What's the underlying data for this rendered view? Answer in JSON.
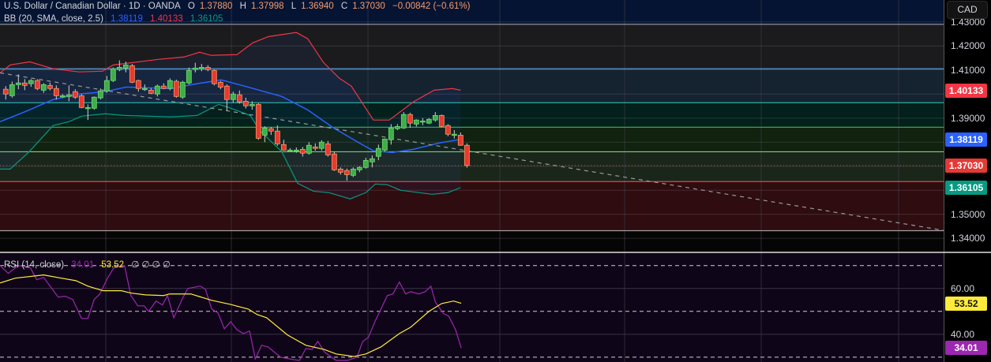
{
  "legend": {
    "symbol": "U.S. Dollar / Canadian Dollar · 1D · OANDA",
    "o_label": "O",
    "o": "1.37880",
    "h_label": "H",
    "h": "1.37998",
    "l_label": "L",
    "l": "1.36940",
    "c_label": "C",
    "c": "1.37030",
    "change": "−0.00842 (−0.61%)",
    "bb_label": "BB (20, SMA, close, 2.5)",
    "bb_basis": "1.38119",
    "bb_upper": "1.40133",
    "bb_lower": "1.36105",
    "rsi_label": "RSI (14, close)",
    "rsi_value": "34.01",
    "rsi_ma": "53.52",
    "rsi_extra": "∅ ∅ ∅ ∅"
  },
  "currency_button": "CAD",
  "colors": {
    "up": "#3fae49",
    "down": "#e8392f",
    "bb_basis": "#2962ff",
    "bb_upper": "#f23645",
    "bb_lower": "#089981",
    "rsi": "#9c27b0",
    "rsi_ma": "#ffeb3b",
    "last_price": "#e53935"
  },
  "price_axis": {
    "ticks": [
      "1.43000",
      "1.42000",
      "1.41000",
      "1.39000",
      "1.35000",
      "1.34000"
    ],
    "badges": [
      {
        "text": "1.40133",
        "color": "#f23645",
        "text_color": "#ffffff"
      },
      {
        "text": "1.38119",
        "color": "#2962ff",
        "text_color": "#ffffff"
      },
      {
        "text": "1.37030",
        "color": "#e53935",
        "text_color": "#ffffff"
      },
      {
        "text": "1.36105",
        "color": "#089981",
        "text_color": "#ffffff"
      }
    ]
  },
  "rsi_axis": {
    "ticks": [
      "60.00",
      "40.00"
    ],
    "badges": [
      {
        "text": "53.52",
        "color": "#ffeb3b",
        "text_color": "#131313"
      },
      {
        "text": "34.01",
        "color": "#9c27b0",
        "text_color": "#ffffff"
      }
    ]
  },
  "chart_data": {
    "type": "candlestick",
    "symbol": "USDCAD",
    "timeframe": "1D",
    "price_range": [
      1.3345,
      1.4391
    ],
    "levels": [
      1.429,
      1.4105,
      1.3964,
      1.3862,
      1.376,
      1.3636,
      1.3432
    ],
    "last_close": 1.3703,
    "trendline": [
      [
        -0.9,
        1.4088
      ],
      [
        148.5,
        1.3433
      ]
    ],
    "candles": [
      [
        1.402,
        1.4033,
        1.3977,
        1.4
      ],
      [
        1.3993,
        1.4052,
        1.3985,
        1.4039
      ],
      [
        1.4039,
        1.4082,
        1.402,
        1.4046
      ],
      [
        1.4046,
        1.4062,
        1.4016,
        1.4036
      ],
      [
        1.4043,
        1.4062,
        1.403,
        1.4056
      ],
      [
        1.4056,
        1.4062,
        1.4016,
        1.4023
      ],
      [
        1.4016,
        1.4045,
        1.4005,
        1.4039
      ],
      [
        1.4036,
        1.4048,
        1.4015,
        1.4023
      ],
      [
        1.4023,
        1.4036,
        1.3977,
        1.3993
      ],
      [
        1.3993,
        1.4,
        1.3985,
        1.3993
      ],
      [
        1.399,
        1.4036,
        1.397,
        1.3997
      ],
      [
        1.401,
        1.402,
        1.398,
        1.3987
      ],
      [
        1.3993,
        1.4,
        1.3941,
        1.3944
      ],
      [
        1.3944,
        1.3957,
        1.3892,
        1.3944
      ],
      [
        1.3941,
        1.399,
        1.3935,
        1.3987
      ],
      [
        1.3984,
        1.4023,
        1.3977,
        1.4013
      ],
      [
        1.4013,
        1.4075,
        1.4005,
        1.4056
      ],
      [
        1.4056,
        1.411,
        1.405,
        1.4105
      ],
      [
        1.4102,
        1.414,
        1.4095,
        1.4111
      ],
      [
        1.4108,
        1.4135,
        1.409,
        1.4121
      ],
      [
        1.4118,
        1.4125,
        1.4045,
        1.4049
      ],
      [
        1.4056,
        1.406,
        1.401,
        1.4023
      ],
      [
        1.4023,
        1.404,
        1.4013,
        1.4023
      ],
      [
        1.4016,
        1.4025,
        1.4,
        1.4003
      ],
      [
        1.4,
        1.404,
        1.399,
        1.4033
      ],
      [
        1.4033,
        1.4045,
        1.402,
        1.4023
      ],
      [
        1.4023,
        1.4065,
        1.4015,
        1.4056
      ],
      [
        1.4053,
        1.406,
        1.3985,
        1.399
      ],
      [
        1.3987,
        1.4055,
        1.398,
        1.4049
      ],
      [
        1.4046,
        1.411,
        1.404,
        1.4098
      ],
      [
        1.4102,
        1.413,
        1.409,
        1.4108
      ],
      [
        1.4105,
        1.4125,
        1.4095,
        1.4111
      ],
      [
        1.4111,
        1.412,
        1.4095,
        1.4102
      ],
      [
        1.4098,
        1.4102,
        1.4036,
        1.4043
      ],
      [
        1.4049,
        1.4055,
        1.402,
        1.4029
      ],
      [
        1.4033,
        1.404,
        1.393,
        1.3977
      ],
      [
        1.3977,
        1.401,
        1.3965,
        1.4
      ],
      [
        1.3997,
        1.4015,
        1.396,
        1.3967
      ],
      [
        1.397,
        1.3985,
        1.394,
        1.3951
      ],
      [
        1.3951,
        1.397,
        1.3935,
        1.3957
      ],
      [
        1.3957,
        1.3962,
        1.381,
        1.3816
      ],
      [
        1.3829,
        1.3866,
        1.38,
        1.3859
      ],
      [
        1.3856,
        1.3863,
        1.383,
        1.3846
      ],
      [
        1.3846,
        1.387,
        1.3785,
        1.3793
      ],
      [
        1.379,
        1.381,
        1.3765,
        1.3767
      ],
      [
        1.3767,
        1.3775,
        1.376,
        1.3767
      ],
      [
        1.3767,
        1.3778,
        1.3756,
        1.3767
      ],
      [
        1.377,
        1.378,
        1.374,
        1.3754
      ],
      [
        1.3754,
        1.38,
        1.3748,
        1.3787
      ],
      [
        1.378,
        1.3795,
        1.3765,
        1.3774
      ],
      [
        1.3774,
        1.3808,
        1.3765,
        1.38
      ],
      [
        1.3793,
        1.3805,
        1.374,
        1.3747
      ],
      [
        1.3751,
        1.376,
        1.368,
        1.3685
      ],
      [
        1.3688,
        1.3695,
        1.3665,
        1.3675
      ],
      [
        1.3682,
        1.369,
        1.364,
        1.3665
      ],
      [
        1.3662,
        1.3695,
        1.3655,
        1.3688
      ],
      [
        1.3685,
        1.37,
        1.3675,
        1.3695
      ],
      [
        1.3695,
        1.3735,
        1.369,
        1.3724
      ],
      [
        1.3718,
        1.3745,
        1.3695,
        1.3731
      ],
      [
        1.3741,
        1.379,
        1.3725,
        1.3774
      ],
      [
        1.3767,
        1.3815,
        1.376,
        1.3813
      ],
      [
        1.381,
        1.3875,
        1.379,
        1.3859
      ],
      [
        1.3856,
        1.3875,
        1.385,
        1.3865
      ],
      [
        1.3859,
        1.3925,
        1.3855,
        1.3915
      ],
      [
        1.3915,
        1.3922,
        1.386,
        1.3879
      ],
      [
        1.3875,
        1.3895,
        1.3865,
        1.3892
      ],
      [
        1.3888,
        1.39,
        1.387,
        1.3888
      ],
      [
        1.3879,
        1.39,
        1.3875,
        1.3895
      ],
      [
        1.3892,
        1.3925,
        1.3885,
        1.3911
      ],
      [
        1.3911,
        1.3915,
        1.3862,
        1.3865
      ],
      [
        1.3869,
        1.3875,
        1.3825,
        1.3833
      ],
      [
        1.3833,
        1.385,
        1.3815,
        1.3833
      ],
      [
        1.3829,
        1.384,
        1.3785,
        1.3787
      ],
      [
        1.3787,
        1.3795,
        1.3694,
        1.3703
      ]
    ],
    "bb_upper": [
      [
        -0.9,
        1.4088
      ],
      [
        0.7,
        1.4121
      ],
      [
        3.8,
        1.4134
      ],
      [
        7.5,
        1.4105
      ],
      [
        11.6,
        1.4092
      ],
      [
        15.3,
        1.4095
      ],
      [
        17,
        1.4121
      ],
      [
        24.1,
        1.4144
      ],
      [
        28.2,
        1.4154
      ],
      [
        30.7,
        1.4174
      ],
      [
        32.5,
        1.4161
      ],
      [
        36.6,
        1.4164
      ],
      [
        39.1,
        1.4213
      ],
      [
        41.6,
        1.4239
      ],
      [
        46,
        1.4256
      ],
      [
        47.8,
        1.423
      ],
      [
        50.3,
        1.4131
      ],
      [
        52.8,
        1.4066
      ],
      [
        54.7,
        1.4033
      ],
      [
        58.2,
        1.3892
      ],
      [
        60.7,
        1.3892
      ],
      [
        64.5,
        1.3967
      ],
      [
        67.8,
        1.4016
      ],
      [
        70.7,
        1.4023
      ],
      [
        72,
        1.4016
      ]
    ],
    "bb_basis": [
      [
        -0.9,
        1.3885
      ],
      [
        3.2,
        1.3928
      ],
      [
        7.5,
        1.3977
      ],
      [
        11.6,
        1.4
      ],
      [
        15.7,
        1.401
      ],
      [
        19.1,
        1.4029
      ],
      [
        22.5,
        1.4026
      ],
      [
        26.2,
        1.4023
      ],
      [
        30.3,
        1.4043
      ],
      [
        34.1,
        1.4059
      ],
      [
        37.8,
        1.4033
      ],
      [
        43.7,
        1.399
      ],
      [
        47.8,
        1.3934
      ],
      [
        51.9,
        1.3859
      ],
      [
        56.2,
        1.3793
      ],
      [
        58.2,
        1.3764
      ],
      [
        61.2,
        1.3757
      ],
      [
        64.5,
        1.377
      ],
      [
        68.7,
        1.3797
      ],
      [
        72,
        1.3812
      ]
    ],
    "bb_lower": [
      [
        -0.9,
        1.3688
      ],
      [
        0.7,
        1.3688
      ],
      [
        3.7,
        1.376
      ],
      [
        7.5,
        1.3869
      ],
      [
        10,
        1.3885
      ],
      [
        12,
        1.3908
      ],
      [
        15.7,
        1.3918
      ],
      [
        18.7,
        1.3911
      ],
      [
        26.2,
        1.3905
      ],
      [
        30.3,
        1.3911
      ],
      [
        33.7,
        1.3957
      ],
      [
        35.3,
        1.3944
      ],
      [
        38.7,
        1.3911
      ],
      [
        40.3,
        1.3846
      ],
      [
        43.7,
        1.376
      ],
      [
        46.2,
        1.3629
      ],
      [
        48.7,
        1.3596
      ],
      [
        51.2,
        1.359
      ],
      [
        54.5,
        1.3564
      ],
      [
        57,
        1.359
      ],
      [
        58.5,
        1.3626
      ],
      [
        60.4,
        1.3623
      ],
      [
        62.5,
        1.36
      ],
      [
        67.5,
        1.3583
      ],
      [
        70,
        1.359
      ],
      [
        72,
        1.3611
      ]
    ],
    "rsi_range": [
      27.9,
      75.4
    ],
    "rsi_bands": [
      70,
      50,
      30
    ],
    "rsi_grid": [
      60,
      40
    ],
    "rsi": [
      [
        -0.9,
        70
      ],
      [
        0.4,
        66.6
      ],
      [
        2,
        70
      ],
      [
        3.9,
        69
      ],
      [
        4.9,
        63.8
      ],
      [
        6,
        64.8
      ],
      [
        8.3,
        56.2
      ],
      [
        9.4,
        56.6
      ],
      [
        10.6,
        55.2
      ],
      [
        12,
        46.9
      ],
      [
        13,
        46.9
      ],
      [
        14,
        55.2
      ],
      [
        14.9,
        57.6
      ],
      [
        16.1,
        64.5
      ],
      [
        17.1,
        69
      ],
      [
        18.8,
        70
      ],
      [
        19.8,
        56.9
      ],
      [
        20.9,
        52.4
      ],
      [
        21.9,
        52.4
      ],
      [
        22.6,
        50
      ],
      [
        23.8,
        54.5
      ],
      [
        24.8,
        52.8
      ],
      [
        25.6,
        56.9
      ],
      [
        26.6,
        47.2
      ],
      [
        27.9,
        55.2
      ],
      [
        28.8,
        60
      ],
      [
        30.8,
        61
      ],
      [
        31.6,
        59.7
      ],
      [
        32.6,
        51
      ],
      [
        33.6,
        49.3
      ],
      [
        34.6,
        42.4
      ],
      [
        35.6,
        45.5
      ],
      [
        36.6,
        42
      ],
      [
        37.6,
        40.3
      ],
      [
        38.6,
        41.4
      ],
      [
        39.5,
        29.3
      ],
      [
        40.5,
        35.2
      ],
      [
        41.5,
        34.5
      ],
      [
        43.5,
        30
      ],
      [
        45.4,
        29
      ],
      [
        46.5,
        28.6
      ],
      [
        47.5,
        33.8
      ],
      [
        48.5,
        33.4
      ],
      [
        49.4,
        36.9
      ],
      [
        50.5,
        32.1
      ],
      [
        52.3,
        28.6
      ],
      [
        54.1,
        28.6
      ],
      [
        55.6,
        30
      ],
      [
        56.5,
        36.9
      ],
      [
        57.4,
        38.6
      ],
      [
        58.5,
        45.9
      ],
      [
        60.4,
        56.9
      ],
      [
        61.3,
        57.6
      ],
      [
        62.3,
        62.8
      ],
      [
        63.3,
        57.6
      ],
      [
        64.1,
        58.6
      ],
      [
        65.4,
        57.6
      ],
      [
        66.4,
        58.6
      ],
      [
        67.3,
        61
      ],
      [
        68,
        54.1
      ],
      [
        69.3,
        49
      ],
      [
        70.1,
        48
      ],
      [
        71.2,
        42
      ],
      [
        72.1,
        34.01
      ]
    ],
    "rsi_ma": [
      [
        -0.9,
        62.4
      ],
      [
        1.5,
        64.5
      ],
      [
        6,
        65.9
      ],
      [
        8.8,
        64.5
      ],
      [
        11.1,
        63.4
      ],
      [
        13,
        61
      ],
      [
        15.4,
        59
      ],
      [
        18.3,
        59
      ],
      [
        19.8,
        58
      ],
      [
        22.1,
        57.2
      ],
      [
        25,
        56.9
      ],
      [
        25.9,
        57.6
      ],
      [
        29.3,
        57.6
      ],
      [
        32.6,
        54.8
      ],
      [
        35.5,
        53.1
      ],
      [
        38.4,
        51
      ],
      [
        39.8,
        48.6
      ],
      [
        41.3,
        47.2
      ],
      [
        44.6,
        39.7
      ],
      [
        47.5,
        35.2
      ],
      [
        50.4,
        33.4
      ],
      [
        52.3,
        31.4
      ],
      [
        55.1,
        30.3
      ],
      [
        57,
        31.4
      ],
      [
        59.4,
        34.5
      ],
      [
        62.3,
        40.3
      ],
      [
        64.1,
        43.1
      ],
      [
        67,
        50
      ],
      [
        69,
        53.4
      ],
      [
        70.9,
        54.5
      ],
      [
        72.1,
        53.52
      ]
    ]
  }
}
